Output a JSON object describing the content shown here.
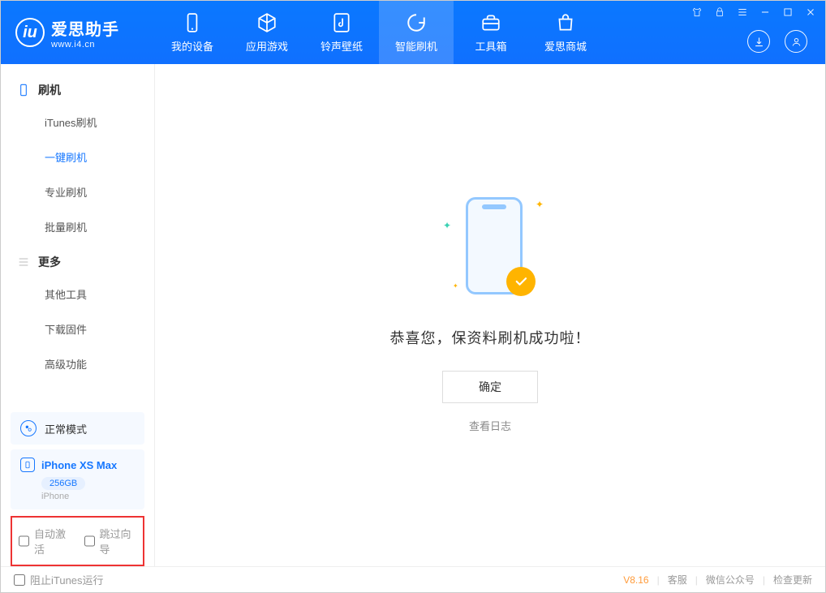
{
  "app": {
    "name": "爱思助手",
    "url": "www.i4.cn"
  },
  "nav": {
    "items": [
      {
        "label": "我的设备"
      },
      {
        "label": "应用游戏"
      },
      {
        "label": "铃声壁纸"
      },
      {
        "label": "智能刷机"
      },
      {
        "label": "工具箱"
      },
      {
        "label": "爱思商城"
      }
    ],
    "activeIndex": 3
  },
  "sidebar": {
    "group1": {
      "title": "刷机",
      "items": [
        "iTunes刷机",
        "一键刷机",
        "专业刷机",
        "批量刷机"
      ],
      "activeIndex": 1
    },
    "group2": {
      "title": "更多",
      "items": [
        "其他工具",
        "下载固件",
        "高级功能"
      ]
    }
  },
  "device": {
    "mode": "正常模式",
    "name": "iPhone XS Max",
    "storage": "256GB",
    "type": "iPhone"
  },
  "options": {
    "autoActivate": "自动激活",
    "skipGuide": "跳过向导"
  },
  "main": {
    "successText": "恭喜您，保资料刷机成功啦！",
    "okButton": "确定",
    "viewLog": "查看日志"
  },
  "footer": {
    "blockItunes": "阻止iTunes运行",
    "version": "V8.16",
    "links": [
      "客服",
      "微信公众号",
      "检查更新"
    ]
  }
}
